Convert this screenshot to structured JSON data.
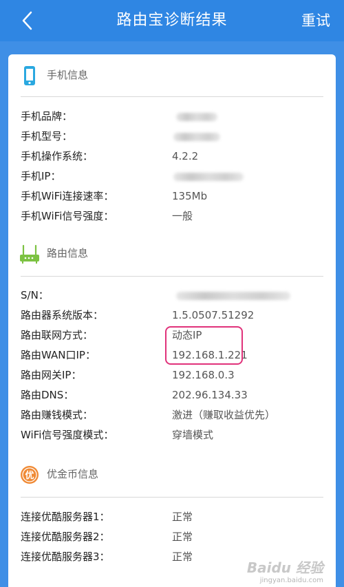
{
  "header": {
    "title": "路由宝诊断结果",
    "retry_label": "重试"
  },
  "sections": {
    "phone": {
      "title": "手机信息",
      "icon": "phone-icon",
      "rows": [
        {
          "label": "手机品牌：",
          "value": ""
        },
        {
          "label": "手机型号：",
          "value": ""
        },
        {
          "label": "手机操作系统：",
          "value": "4.2.2"
        },
        {
          "label": "手机IP：",
          "value": ""
        },
        {
          "label": "手机WiFi连接速率：",
          "value": "135Mb"
        },
        {
          "label": "手机WiFi信号强度：",
          "value": "一般"
        }
      ]
    },
    "router": {
      "title": "路由信息",
      "icon": "router-icon",
      "rows": [
        {
          "label": "S/N：",
          "value": ""
        },
        {
          "label": "路由器系统版本：",
          "value": "1.5.0507.51292"
        },
        {
          "label": "路由联网方式：",
          "value": "动态IP"
        },
        {
          "label": "路由WAN口IP：",
          "value": "192.168.1.221"
        },
        {
          "label": "路由网关IP：",
          "value": "192.168.0.3"
        },
        {
          "label": "路由DNS：",
          "value": "202.96.134.33"
        },
        {
          "label": "路由赚钱模式：",
          "value": "激进（赚取收益优先）"
        },
        {
          "label": "WiFi信号强度模式：",
          "value": "穿墙模式"
        }
      ]
    },
    "coin": {
      "title": "优金币信息",
      "icon": "coin-icon",
      "icon_text": "优",
      "rows": [
        {
          "label": "连接优酷服务器1：",
          "value": "正常"
        },
        {
          "label": "连接优酷服务器2：",
          "value": "正常"
        },
        {
          "label": "连接优酷服务器3：",
          "value": "正常"
        }
      ]
    }
  },
  "watermark": {
    "text": "Baidu 经验",
    "url": "jingyan.baidu.com"
  },
  "colors": {
    "header_bg": "#2f86e3",
    "highlight": "#e0317a",
    "router_icon": "#7cc242",
    "coin_icon": "#f08a35",
    "phone_icon": "#2aa8e0"
  }
}
